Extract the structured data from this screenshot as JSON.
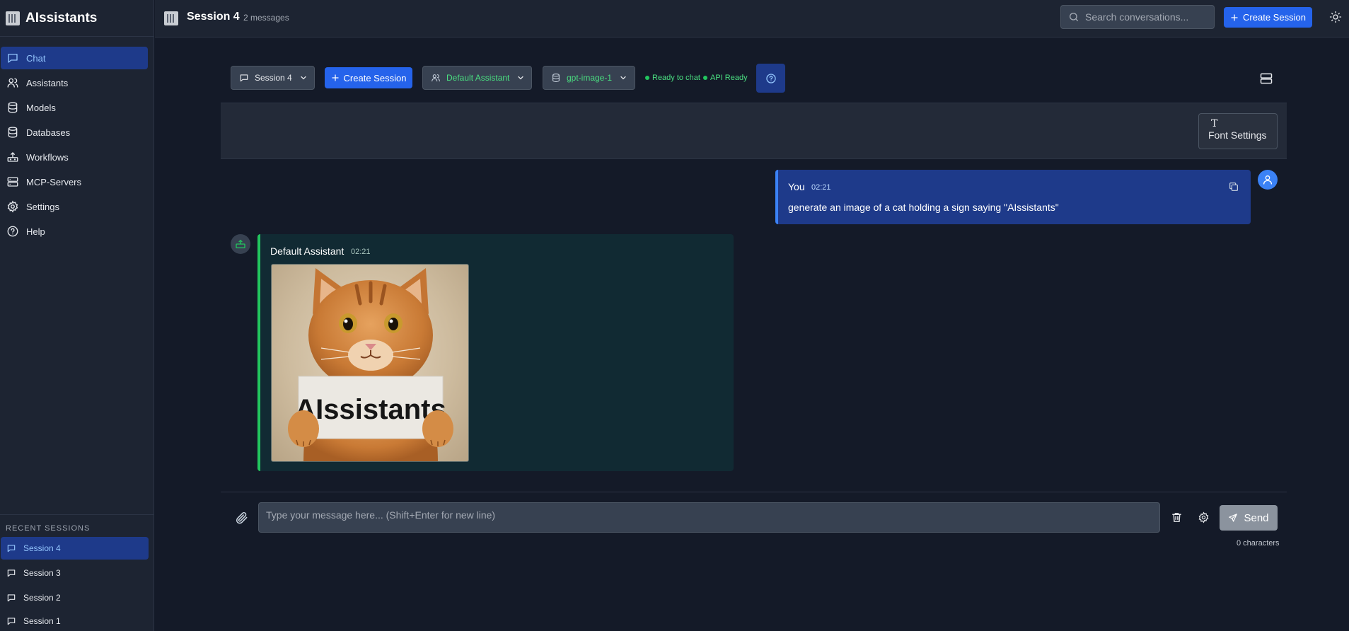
{
  "app": {
    "name": "AIssistants"
  },
  "sidebar": {
    "items": [
      {
        "label": "Chat",
        "icon": "chat-icon",
        "active": true
      },
      {
        "label": "Assistants",
        "icon": "users-icon"
      },
      {
        "label": "Models",
        "icon": "database-icon"
      },
      {
        "label": "Databases",
        "icon": "database-icon"
      },
      {
        "label": "Workflows",
        "icon": "workflow-icon"
      },
      {
        "label": "MCP-Servers",
        "icon": "server-icon"
      },
      {
        "label": "Settings",
        "icon": "gear-icon"
      },
      {
        "label": "Help",
        "icon": "help-icon"
      }
    ],
    "recent_title": "RECENT SESSIONS",
    "recent": [
      {
        "label": "Session 4",
        "active": true
      },
      {
        "label": "Session 3"
      },
      {
        "label": "Session 2"
      },
      {
        "label": "Session 1"
      }
    ]
  },
  "header": {
    "session_title": "Session 4",
    "message_count": "2 messages",
    "search_placeholder": "Search conversations...",
    "create_label": "Create Session"
  },
  "toolbar": {
    "session_select": "Session 4",
    "create_label": "Create Session",
    "assistant_select": "Default Assistant",
    "model_select": "gpt-image-1",
    "status_ready": "Ready to chat",
    "status_api": "API Ready"
  },
  "font_settings": {
    "icon_glyph": "T",
    "label": "Font Settings"
  },
  "messages": [
    {
      "role": "user",
      "author": "You",
      "time": "02:21",
      "text": "generate an image of a cat holding a sign saying \"AIssistants\""
    },
    {
      "role": "assistant",
      "author": "Default Assistant",
      "time": "02:21",
      "image_sign_text": "AIssistants"
    }
  ],
  "composer": {
    "placeholder": "Type your message here... (Shift+Enter for new line)",
    "value": "",
    "send_label": "Send",
    "char_count": "0 characters"
  },
  "colors": {
    "accent": "#2563eb",
    "active_nav": "#1e3a8a",
    "status_green": "#22c55e",
    "user_bubble": "#1e3a8a",
    "assistant_bubble": "#112a33",
    "background": "#141a28"
  }
}
